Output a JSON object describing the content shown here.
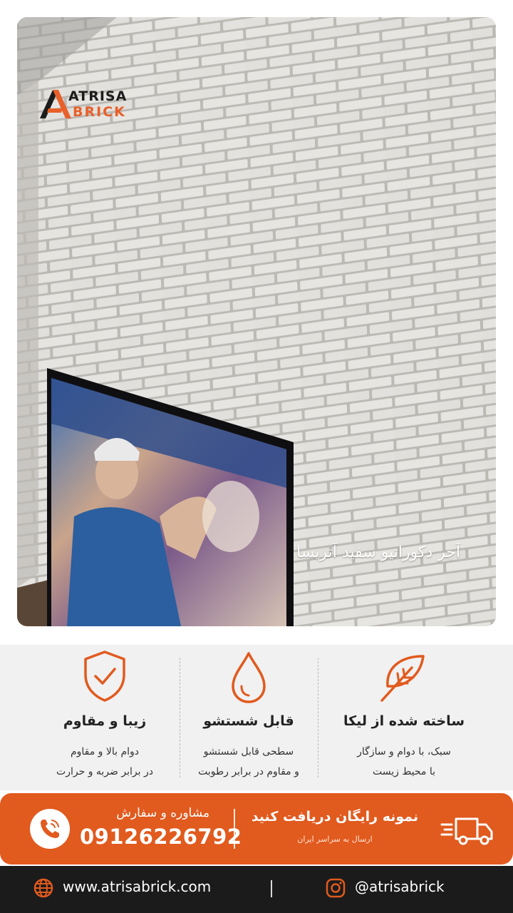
{
  "brand": {
    "name_line1": "ATRISA",
    "name_line2": "BRICK",
    "accent_color": "#e15a1e"
  },
  "hero": {
    "caption": "آجر دکوراتیو سفید آتریسا"
  },
  "features": [
    {
      "icon": "leaf-icon",
      "title": "ساخته شده از لیکا",
      "desc": "سبک، با دوام و سازگار\nبا محیط زیست"
    },
    {
      "icon": "water-drop-icon",
      "title": "قابل شستشو",
      "desc": "سطحی قابل شستشو\nو مقاوم در برابر رطوبت"
    },
    {
      "icon": "shield-check-icon",
      "title": "زیبا و مقاوم",
      "desc": "دوام بالا و مقاوم\nدر برابر ضربه و حرارت"
    }
  ],
  "cta": {
    "consult_label": "مشاوره و سفارش",
    "phone": "09126226792",
    "sample_title": "نمونه رایگان دریافت کنید",
    "shipping_note": "ارسال به سراسر ایران",
    "icons": [
      "phone-icon",
      "delivery-truck-icon"
    ]
  },
  "footer": {
    "website": "www.atrisabrick.com",
    "instagram": "@atrisabrick",
    "icons": [
      "globe-icon",
      "instagram-icon"
    ]
  }
}
